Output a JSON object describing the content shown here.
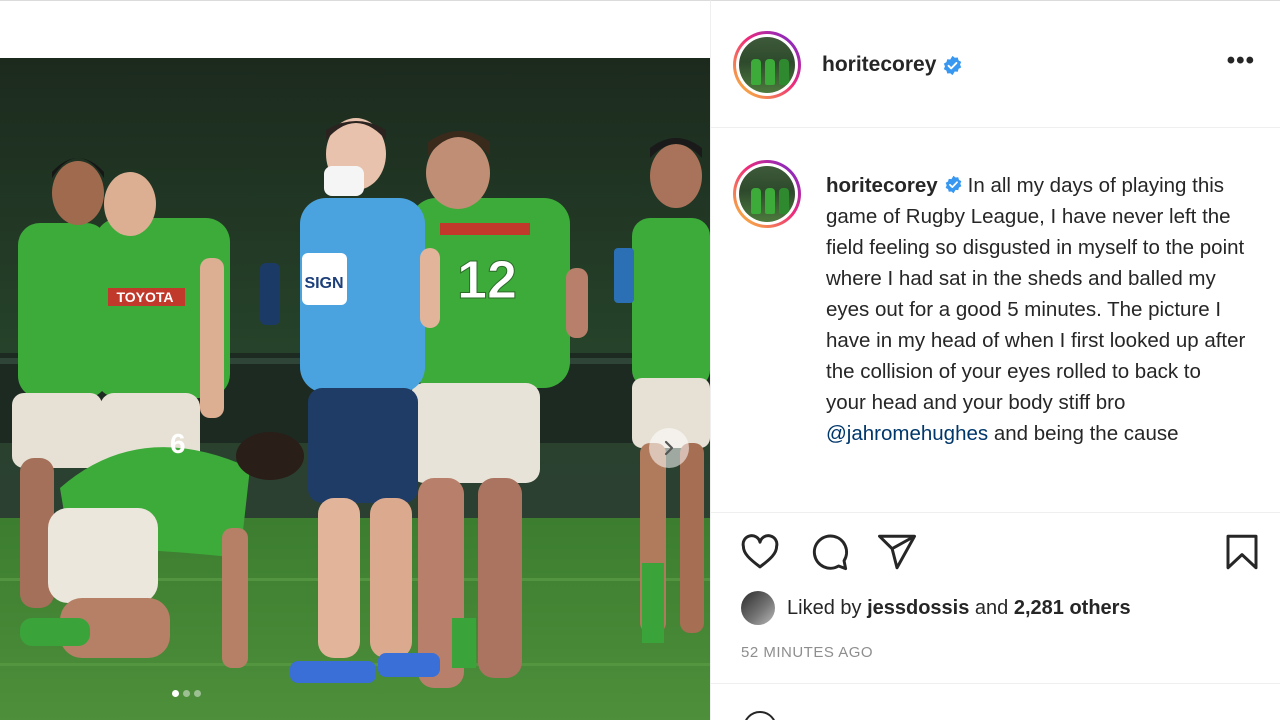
{
  "post": {
    "username": "horitecorey",
    "verified": true,
    "more_label": "•••",
    "caption": {
      "username": "horitecorey",
      "text_before_mention": "In all my days of playing this game of Rugby League, I have never left the field feeling so disgusted in myself to the point where I had sat in the sheds and balled my eyes out for a good 5 minutes. The picture I have in my head of when I first looked up after the collision of your eyes rolled to back to your head and your body stiff bro",
      "mention": "@jahromehughes",
      "text_after_mention": "and being the cause"
    },
    "likes": {
      "prefix": "Liked by",
      "first_user": "jessdossis",
      "connector": "and",
      "others": "2,281 others"
    },
    "timestamp": "52 MINUTES AGO"
  },
  "photo": {
    "jersey_sponsor": "TOYOTA",
    "jersey_number_center": "12",
    "trainer_shirt_logo": "SIGN",
    "carousel": {
      "total": 3,
      "active": 0
    }
  },
  "icons": [
    "heart-icon",
    "comment-icon",
    "share-icon",
    "bookmark-icon",
    "more-icon",
    "verified-badge-icon",
    "chevron-right-icon",
    "emoji-icon"
  ],
  "colors": {
    "verified": "#3897f0",
    "mention": "#00376b",
    "jersey_green": "#3dab3a",
    "trainer_blue": "#4aa3df"
  }
}
